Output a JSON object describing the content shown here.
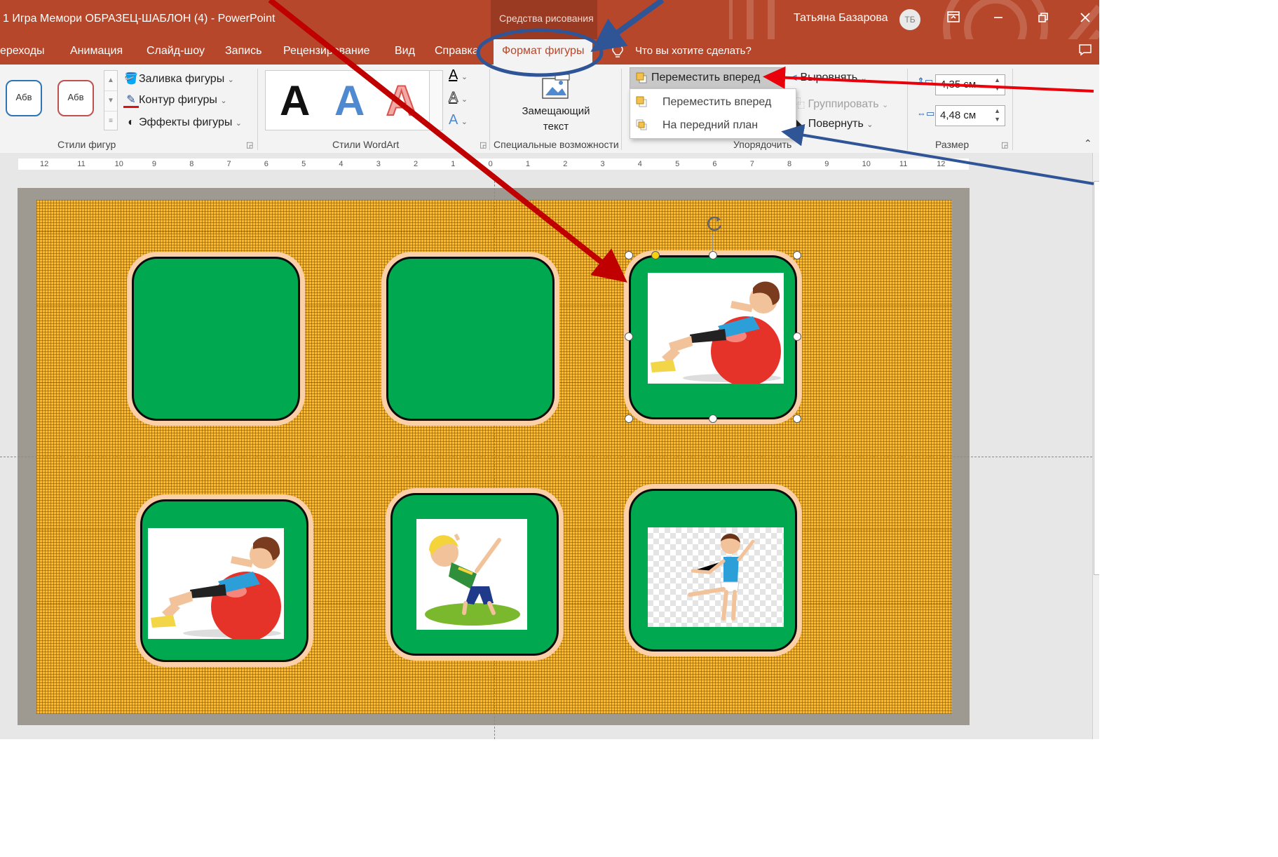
{
  "window": {
    "title": "1 Игра Мемори ОБРАЗЕЦ-ШАБЛОН (4)  -  PowerPoint",
    "context_group": "Средства рисования",
    "user_name": "Татьяна Базарова",
    "user_initials": "ТБ"
  },
  "tabs": [
    "ереходы",
    "Анимация",
    "Слайд-шоу",
    "Запись",
    "Рецензирование",
    "Вид",
    "Справка",
    "Формат фигуры"
  ],
  "tell_me": "Что вы хотите сделать?",
  "ribbon": {
    "shape_styles": {
      "thumb1": "Абв",
      "thumb2": "Абв",
      "fill": "Заливка фигуры",
      "outline": "Контур фигуры",
      "effects": "Эффекты фигуры",
      "label": "Стили фигур"
    },
    "wordart": {
      "letter": "A",
      "label": "Стили WordArt"
    },
    "accessibility": {
      "alt_text_line1": "Замещающий",
      "alt_text_line2": "текст",
      "label": "Специальные возможности"
    },
    "arrange": {
      "bring_forward": "Переместить вперед",
      "align": "Выровнять",
      "group": "Группировать",
      "rotate": "Повернуть",
      "label": "Упорядочить",
      "menu": [
        "Переместить вперед",
        "На передний план"
      ]
    },
    "size": {
      "height": "4,35 см",
      "width": "4,48 см",
      "label": "Размер"
    }
  },
  "ruler": [
    "12",
    "11",
    "10",
    "9",
    "8",
    "7",
    "6",
    "5",
    "4",
    "3",
    "2",
    "1",
    "0",
    "1",
    "2",
    "3",
    "4",
    "5",
    "6",
    "7",
    "8",
    "9",
    "10",
    "11",
    "12"
  ],
  "cards": [
    {
      "position": "top-left",
      "picture": "none"
    },
    {
      "position": "top-middle",
      "picture": "none"
    },
    {
      "position": "top-right",
      "picture": "girl-on-fitness-ball",
      "selected": true
    },
    {
      "position": "bottom-left",
      "picture": "girl-on-fitness-ball"
    },
    {
      "position": "bottom-middle",
      "picture": "girl-stretching"
    },
    {
      "position": "bottom-right",
      "picture": "boy-ballet-pose"
    }
  ],
  "colors": {
    "accent": "#b7472a",
    "slide_background": "#fdb82b",
    "card_fill": "#00a84f",
    "card_glow": "#fbcfa8",
    "arrow_red": "#c00000",
    "arrow_blue": "#2f5597"
  }
}
